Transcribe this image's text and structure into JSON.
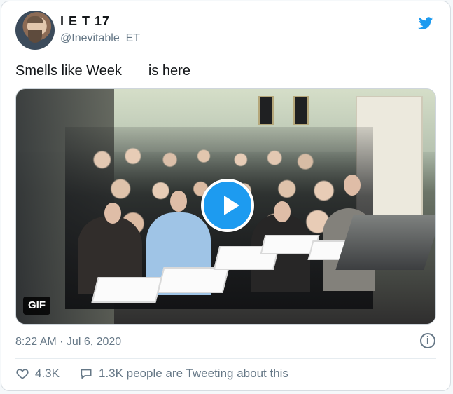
{
  "tweet": {
    "display_name": "I E T 17",
    "handle": "@Inevitable_ET",
    "text_part1": "Smells like Week",
    "text_part2": "is here",
    "timestamp": "8:22 AM · Jul 6, 2020",
    "media_badge": "GIF",
    "likes_count": "4.3K",
    "comments_text": "1.3K people are Tweeting about this"
  },
  "icons": {
    "twitter_logo": "twitter-bird-icon",
    "play_button": "play-icon",
    "info": "info-icon",
    "likes": "heart-icon",
    "comments": "speech-bubble-icon"
  },
  "colors": {
    "twitter_blue": "#1d9bf0",
    "muted_text": "#657786",
    "card_border": "#d7dde2"
  }
}
